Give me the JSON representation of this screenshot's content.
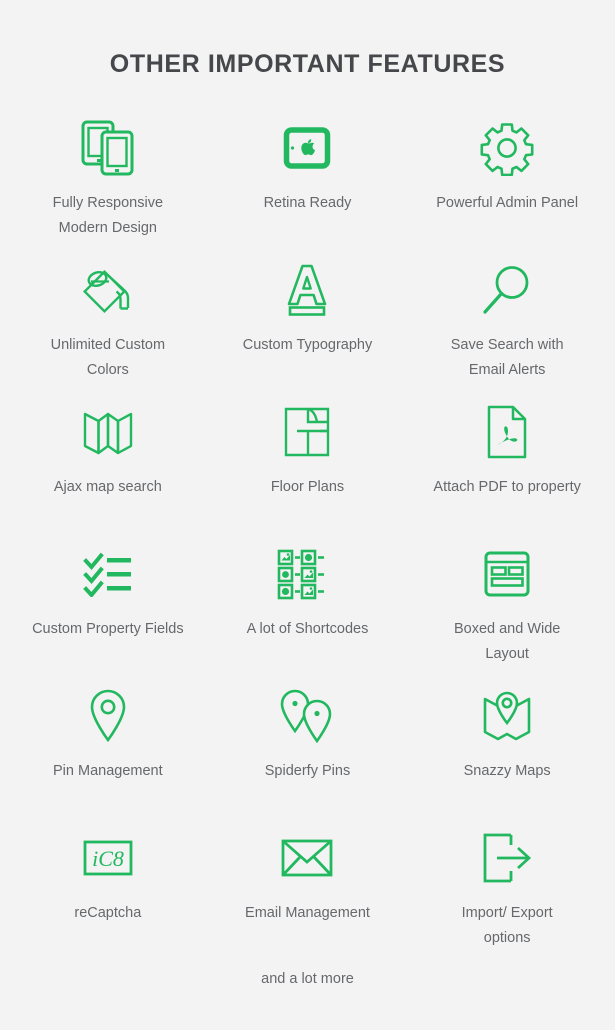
{
  "header": {
    "title": "OTHER IMPORTANT FEATURES"
  },
  "colors": {
    "accent": "#22b85f",
    "background": "#f3f3f3",
    "title": "#45474a",
    "label": "#66686b"
  },
  "features": [
    {
      "icon": "responsive-devices-icon",
      "label": "Fully Responsive\nModern Design"
    },
    {
      "icon": "retina-apple-tablet-icon",
      "label": "Retina Ready"
    },
    {
      "icon": "gear-icon",
      "label": "Powerful Admin Panel"
    },
    {
      "icon": "paint-bucket-icon",
      "label": "Unlimited Custom\nColors"
    },
    {
      "icon": "typography-letter-a-icon",
      "label": "Custom Typography"
    },
    {
      "icon": "magnifier-search-icon",
      "label": "Save Search with\nEmail Alerts"
    },
    {
      "icon": "folded-map-icon",
      "label": "Ajax map search"
    },
    {
      "icon": "floor-plan-icon",
      "label": "Floor  Plans"
    },
    {
      "icon": "pdf-document-icon",
      "label": "Attach PDF to property"
    },
    {
      "icon": "checklist-icon",
      "label": "Custom Property Fields"
    },
    {
      "icon": "shortcodes-grid-icon",
      "label": "A lot of Shortcodes"
    },
    {
      "icon": "layout-boxed-icon",
      "label": "Boxed and Wide\nLayout"
    },
    {
      "icon": "map-pin-icon",
      "label": "Pin Management"
    },
    {
      "icon": "double-map-pin-icon",
      "label": "Spiderfy Pins"
    },
    {
      "icon": "map-with-pin-icon",
      "label": "Snazzy Maps"
    },
    {
      "icon": "recaptcha-box-icon",
      "label": "reCaptcha"
    },
    {
      "icon": "envelope-icon",
      "label": "Email Management"
    },
    {
      "icon": "export-arrow-icon",
      "label": "Import/ Export\noptions"
    }
  ],
  "captcha": {
    "text": "iC8"
  },
  "footer": {
    "note": "and a lot more"
  }
}
